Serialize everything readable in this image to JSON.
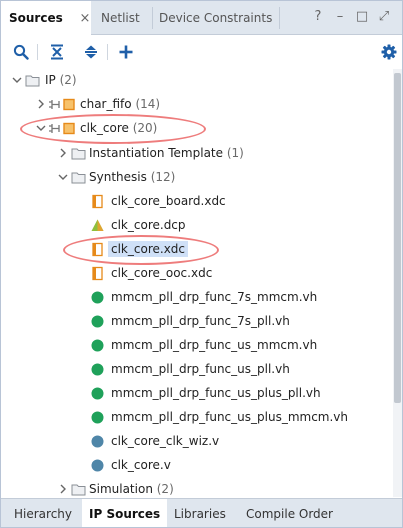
{
  "tabs": [
    {
      "label": "Sources",
      "active": true
    },
    {
      "label": "Netlist",
      "active": false
    },
    {
      "label": "Device Constraints",
      "active": false
    }
  ],
  "tab_close_glyph": "×",
  "window_controls": [
    "?",
    "–",
    "□",
    "⤢"
  ],
  "toolbar": {
    "icons": [
      "search-icon",
      "collapse-all-icon",
      "expand-all-icon",
      "add-icon",
      "gear-icon"
    ]
  },
  "tree": {
    "ip": {
      "label": "IP",
      "count": "(2)"
    },
    "char_fifo": {
      "label": "char_fifo",
      "count": "(14)"
    },
    "clk_core": {
      "label": "clk_core",
      "count": "(20)"
    },
    "instantiation_template": {
      "label": "Instantiation Template",
      "count": "(1)"
    },
    "synthesis": {
      "label": "Synthesis",
      "count": "(12)"
    },
    "files": [
      {
        "label": "clk_core_board.xdc",
        "icon": "xdc-file-icon"
      },
      {
        "label": "clk_core.dcp",
        "icon": "dcp-file-icon"
      },
      {
        "label": "clk_core.xdc",
        "icon": "xdc-file-icon",
        "selected": true
      },
      {
        "label": "clk_core_ooc.xdc",
        "icon": "xdc-file-icon"
      },
      {
        "label": "mmcm_pll_drp_func_7s_mmcm.vh",
        "icon": "green-dot-icon"
      },
      {
        "label": "mmcm_pll_drp_func_7s_pll.vh",
        "icon": "green-dot-icon"
      },
      {
        "label": "mmcm_pll_drp_func_us_mmcm.vh",
        "icon": "green-dot-icon"
      },
      {
        "label": "mmcm_pll_drp_func_us_pll.vh",
        "icon": "green-dot-icon"
      },
      {
        "label": "mmcm_pll_drp_func_us_plus_pll.vh",
        "icon": "green-dot-icon"
      },
      {
        "label": "mmcm_pll_drp_func_us_plus_mmcm.vh",
        "icon": "green-dot-icon"
      },
      {
        "label": "clk_core_clk_wiz.v",
        "icon": "blue-dot-icon"
      },
      {
        "label": "clk_core.v",
        "icon": "blue-dot-icon"
      }
    ],
    "simulation": {
      "label": "Simulation",
      "count": "(2)"
    }
  },
  "bottom_tabs": [
    {
      "label": "Hierarchy",
      "active": false
    },
    {
      "label": "IP Sources",
      "active": true
    },
    {
      "label": "Libraries",
      "active": false
    },
    {
      "label": "Compile Order",
      "active": false
    }
  ],
  "colors": {
    "accent": "#1f5fa8",
    "annotation": "#ee7c7c",
    "selection": "#cfe0f7",
    "green_dot": "#1fa15a",
    "blue_dot": "#4f86a8",
    "ip_orange": "#e68a1a"
  }
}
